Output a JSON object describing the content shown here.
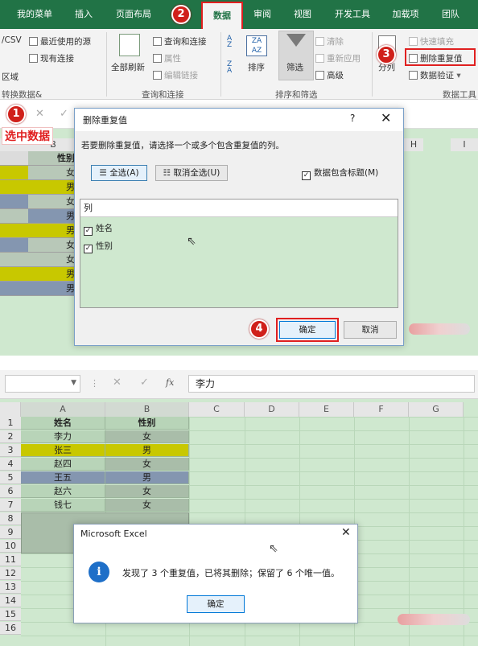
{
  "top": {
    "tabs": [
      "我的菜单",
      "插入",
      "页面布局",
      "数据",
      "审阅",
      "视图",
      "开发工具",
      "加载项",
      "团队"
    ],
    "active_tab": "数据",
    "ribbon": {
      "csv": "/CSV",
      "recent_sources": "最近使用的源",
      "existing_connections": "现有连接",
      "area": "区域",
      "group_get_transform": "转换数据&",
      "refresh_all": "全部刷新",
      "queries_connections": "查询和连接",
      "properties": "属性",
      "edit_links": "编辑链接",
      "group_queries": "查询和连接",
      "sort": "排序",
      "filter": "筛选",
      "clear": "清除",
      "reapply": "重新应用",
      "advanced": "高级",
      "group_sort_filter": "排序和筛选",
      "flash_fill": "快速填充",
      "remove_duplicates": "删除重复值",
      "data_validation": "数据验证",
      "column": "分列",
      "group_data_tools": "数据工具"
    },
    "badges": [
      "1",
      "2",
      "3",
      "4"
    ],
    "select_data_note": "选中数据",
    "col_b": "B",
    "header_cell": "性别",
    "col_values": [
      "女",
      "男",
      "女",
      "男",
      "男",
      "女",
      "女",
      "男",
      "男"
    ],
    "col_h": "H",
    "col_i": "I",
    "dialog": {
      "title": "删除重复值",
      "help": "?",
      "close": "✕",
      "instruction": "若要删除重复值，请选择一个或多个包含重复值的列。",
      "select_all": "全选(A)",
      "unselect_all": "取消全选(U)",
      "has_headers": "数据包含标题(M)",
      "list_header": "列",
      "columns": [
        "姓名",
        "性别"
      ],
      "ok": "确定",
      "cancel": "取消"
    }
  },
  "bottom": {
    "name_box": "",
    "cancel_icon": "✕",
    "enter_icon": "✓",
    "fx": "fx",
    "formula": "李力",
    "col_headers": [
      "A",
      "B",
      "C",
      "D",
      "E",
      "F",
      "G"
    ],
    "row_numbers": [
      "1",
      "2",
      "3",
      "4",
      "5",
      "6",
      "7",
      "8",
      "9",
      "10",
      "11",
      "12",
      "13",
      "14",
      "15",
      "16"
    ],
    "table_header": [
      "姓名",
      "性别"
    ],
    "rows": [
      [
        "李力",
        "女"
      ],
      [
        "张三",
        "男"
      ],
      [
        "赵四",
        "女"
      ],
      [
        "王五",
        "男"
      ],
      [
        "赵六",
        "女"
      ],
      [
        "钱七",
        "女"
      ]
    ],
    "dialog": {
      "title": "Microsoft Excel",
      "close": "✕",
      "info_icon": "i",
      "message": "发现了 3 个重复值，已将其删除；保留了 6 个唯一值。",
      "ok": "确定"
    }
  },
  "colors": {
    "excel_green": "#217346",
    "yellow_row": "#c8c800",
    "blue_row": "#8496b0",
    "sheet_green": "#cfe8cf",
    "badge_red": "#d0201a"
  }
}
